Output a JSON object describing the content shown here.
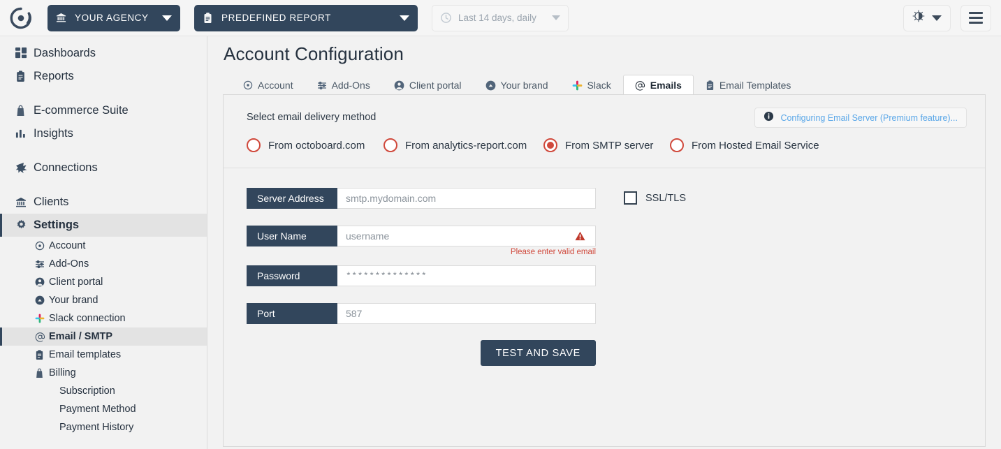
{
  "topbar": {
    "logo_icon": "octoboard-logo-icon",
    "agency": {
      "icon": "bank-icon",
      "label": "YOUR AGENCY",
      "caret": "chevron-down-icon"
    },
    "report": {
      "icon": "clipboard-icon",
      "label": "PREDEFINED REPORT",
      "caret": "chevron-down-icon"
    },
    "date_range": {
      "icon": "clock-icon",
      "label": "Last 14 days, daily",
      "caret": "chevron-down-icon"
    },
    "theme_button": {
      "icon": "brightness-icon",
      "caret": "chevron-down-icon"
    },
    "menu_button": {
      "icon": "hamburger-menu-icon"
    }
  },
  "sidebar": {
    "items": [
      {
        "label": "Dashboards",
        "icon": "grid-icon"
      },
      {
        "label": "Reports",
        "icon": "clipboard-icon"
      },
      {
        "label": "E-commerce Suite",
        "icon": "bag-icon"
      },
      {
        "label": "Insights",
        "icon": "bar-chart-icon"
      },
      {
        "label": "Connections",
        "icon": "plug-icon"
      },
      {
        "label": "Clients",
        "icon": "bank-icon"
      },
      {
        "label": "Settings",
        "icon": "gear-icon"
      }
    ],
    "sub_items": [
      {
        "label": "Account",
        "icon": "target-icon"
      },
      {
        "label": "Add-Ons",
        "icon": "sliders-icon"
      },
      {
        "label": "Client portal",
        "icon": "user-circle-icon"
      },
      {
        "label": "Your brand",
        "icon": "brand-arrow-icon"
      },
      {
        "label": "Slack connection",
        "icon": "slack-icon"
      },
      {
        "label": "Email / SMTP",
        "icon": "at-icon"
      },
      {
        "label": "Email templates",
        "icon": "clipboard-icon"
      },
      {
        "label": "Billing",
        "icon": "bag-icon"
      }
    ],
    "billing_children": [
      {
        "label": "Subscription"
      },
      {
        "label": "Payment Method"
      },
      {
        "label": "Payment History"
      }
    ]
  },
  "main": {
    "page_title": "Account Configuration",
    "tabs": [
      {
        "label": "Account",
        "icon": "target-icon"
      },
      {
        "label": "Add-Ons",
        "icon": "sliders-icon"
      },
      {
        "label": "Client portal",
        "icon": "user-circle-icon"
      },
      {
        "label": "Your brand",
        "icon": "brand-arrow-icon"
      },
      {
        "label": "Slack",
        "icon": "slack-icon"
      },
      {
        "label": "Emails",
        "icon": "at-icon"
      },
      {
        "label": "Email Templates",
        "icon": "clipboard-icon"
      }
    ],
    "delivery": {
      "section_label": "Select email delivery method",
      "premium": {
        "icon": "info-icon",
        "link_text": "Configuring Email Server (Premium feature)..."
      },
      "options": [
        {
          "label": "From octoboard.com",
          "checked": false
        },
        {
          "label": "From analytics-report.com",
          "checked": false
        },
        {
          "label": "From SMTP server",
          "checked": true
        },
        {
          "label": "From Hosted Email Service",
          "checked": false
        }
      ]
    },
    "form": {
      "fields": [
        {
          "label": "Server Address",
          "value": "smtp.mydomain.com",
          "error": ""
        },
        {
          "label": "User Name",
          "value": "username",
          "error": "Please enter valid email",
          "warn_icon": "warning-triangle-icon"
        },
        {
          "label": "Password",
          "value": "**************",
          "error": ""
        },
        {
          "label": "Port",
          "value": "587",
          "error": ""
        }
      ],
      "save_label": "TEST AND SAVE",
      "ssl": {
        "label": "SSL/TLS",
        "checked": false
      }
    }
  },
  "colors": {
    "dark_navy": "#32465c",
    "radio_red": "#d0493c",
    "link_blue": "#5aa7e8",
    "page_bg": "#f2f2f2",
    "error_red": "#d0493c"
  }
}
